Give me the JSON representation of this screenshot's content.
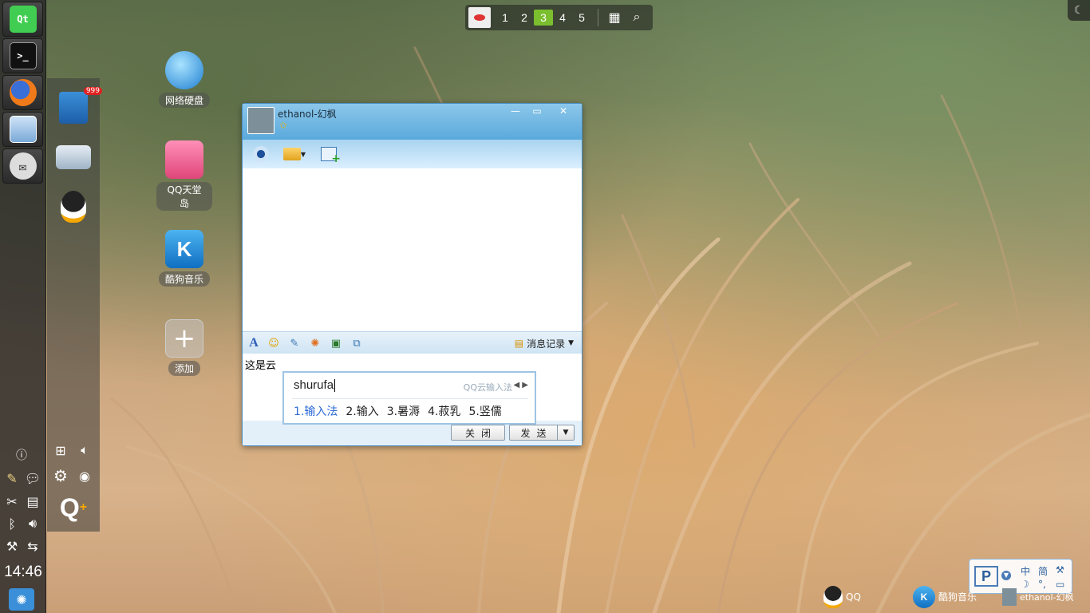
{
  "desktop": {
    "clock": "14:46",
    "badge_count": "999"
  },
  "workspaces": {
    "items": [
      "1",
      "2",
      "3",
      "4",
      "5"
    ],
    "active": "3"
  },
  "desktop_icons": [
    {
      "label": "网络硬盘"
    },
    {
      "label": "QQ天堂岛"
    },
    {
      "label": "酷狗音乐"
    },
    {
      "label": "添加"
    }
  ],
  "chat": {
    "contact_name": "ethanol-幻枫",
    "history_label": "消息记录",
    "input_text": "这是云",
    "close_label": "关闭",
    "send_label": "发送"
  },
  "ime": {
    "composition": "shurufa",
    "brand": "QQ云输入法",
    "candidates": [
      "1.输入法",
      "2.输入",
      "3.暑溽",
      "4.菽乳",
      "5.竖儒"
    ]
  },
  "ime_status": {
    "mode": "中",
    "script": "简"
  },
  "taskbar": {
    "items": [
      "QQ",
      "酷狗音乐",
      "ethanol-幻枫"
    ]
  },
  "colors": {
    "workspace_active": "#7bbf2e",
    "ime_selected": "#2c6ad6",
    "window_border": "#4a8cc2"
  }
}
